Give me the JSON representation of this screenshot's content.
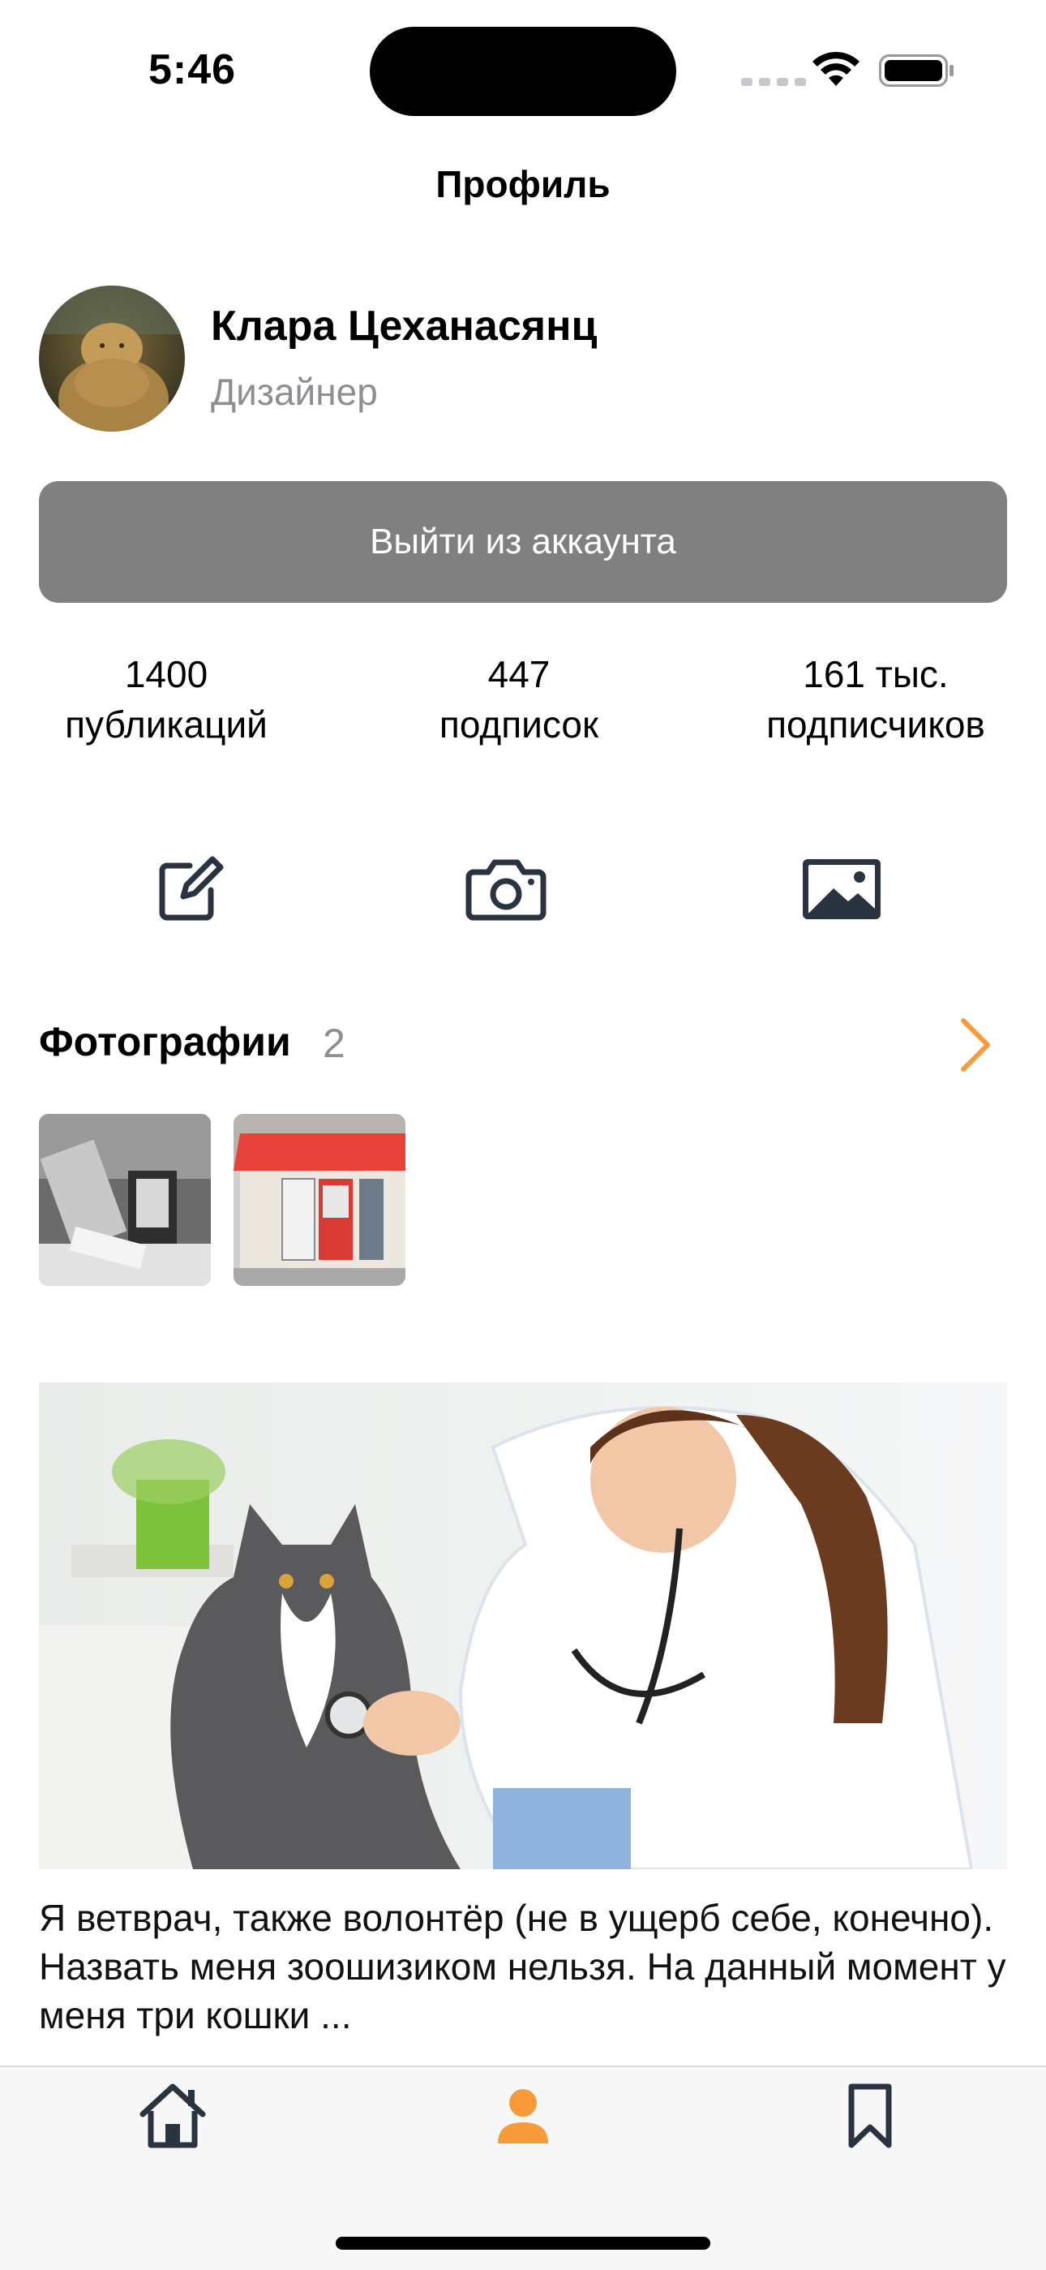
{
  "status_bar": {
    "time": "5:46"
  },
  "nav": {
    "title": "Профиль"
  },
  "profile": {
    "name": "Клара Цеханасянц",
    "role": "Дизайнер",
    "logout_label": "Выйти из аккаунта"
  },
  "stats": [
    {
      "value": "1400",
      "label": "публикаций"
    },
    {
      "value": "447",
      "label": "подписок"
    },
    {
      "value": "161 тыс.",
      "label": "подписчиков"
    }
  ],
  "actions": [
    "edit-icon",
    "camera-icon",
    "gallery-icon"
  ],
  "photos": {
    "title": "Фотографии",
    "count": "2"
  },
  "post": {
    "text": "Я ветврач, также волонтёр (не в ущерб себе, конечно). Назвать меня зоошизиком нельзя. На данный момент у меня три кошки  ..."
  },
  "tabs": [
    {
      "icon": "home-icon",
      "active": false
    },
    {
      "icon": "person-icon",
      "active": true
    },
    {
      "icon": "bookmark-icon",
      "active": false
    }
  ],
  "colors": {
    "accent": "#F69A3A",
    "icon": "#2A3440",
    "logout_bg": "#808080",
    "secondary_text": "#8E8E93"
  }
}
